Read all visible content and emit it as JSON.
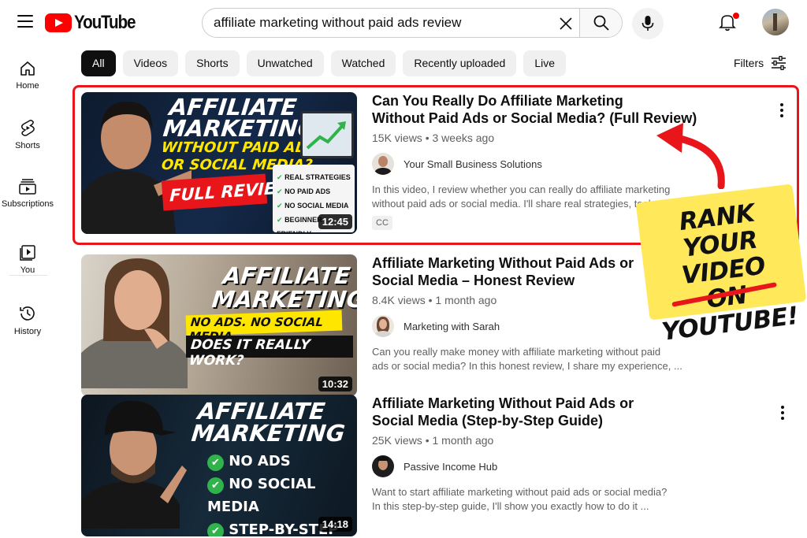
{
  "header": {
    "logo_text": "YouTube",
    "search_value": "affiliate marketing without paid ads review"
  },
  "sidebar": {
    "items": [
      {
        "label": "Home",
        "icon": "home-icon"
      },
      {
        "label": "Shorts",
        "icon": "shorts-icon"
      },
      {
        "label": "Subscriptions",
        "icon": "subscriptions-icon"
      },
      {
        "label": "You",
        "icon": "you-icon"
      },
      {
        "label": "History",
        "icon": "history-icon"
      }
    ]
  },
  "chips": [
    "All",
    "Videos",
    "Shorts",
    "Unwatched",
    "Watched",
    "Recently uploaded",
    "Live"
  ],
  "filters_label": "Filters",
  "results": [
    {
      "title_line1": "Can You Really Do Affiliate Marketing",
      "title_line2": "Without Paid Ads or Social Media? (Full Review)",
      "views": "15K views",
      "age": "3 weeks ago",
      "channel": "Your Small Business Solutions",
      "desc_line1": "In this video, I review whether you can really do affiliate marketing",
      "desc_line2": "without paid ads or social media. I'll share real strategies, tools, ...",
      "badge": "CC",
      "duration": "12:45",
      "thumb": {
        "line1": "AFFILIATE",
        "line2": "MARKETING",
        "line3": "WITHOUT PAID ADS",
        "line4": "OR SOCIAL MEDIA?",
        "banner": "FULL REVIEW",
        "checks": [
          "REAL STRATEGIES",
          "NO PAID ADS",
          "NO SOCIAL MEDIA",
          "BEGINNER FRIENDLY"
        ]
      }
    },
    {
      "title_line1": "Affiliate Marketing Without Paid Ads or",
      "title_line2": "Social Media – Honest Review",
      "views": "8.4K views",
      "age": "1 month ago",
      "channel": "Marketing with Sarah",
      "desc_line1": "Can you really make money with affiliate marketing without paid",
      "desc_line2": "ads or social media? In this honest review, I share my experience, ...",
      "duration": "10:32",
      "thumb": {
        "line1": "AFFILIATE",
        "line2": "MARKETING",
        "line3": "NO ADS. NO SOCIAL MEDIA.",
        "line4": "DOES IT REALLY WORK?"
      }
    },
    {
      "title_line1": "Affiliate Marketing Without Paid Ads or",
      "title_line2": "Social Media (Step-by-Step Guide)",
      "views": "25K views",
      "age": "1 month ago",
      "channel": "Passive Income Hub",
      "desc_line1": "Want to start affiliate marketing without paid ads or social media?",
      "desc_line2": "In this step-by-step guide, I'll show you exactly how to do it ...",
      "duration": "14:18",
      "thumb": {
        "line1": "AFFILIATE",
        "line2": "MARKETING",
        "checks": [
          "NO ADS",
          "NO SOCIAL MEDIA",
          "STEP-BY-STEP"
        ]
      }
    }
  ],
  "promo": {
    "line1": "RANK",
    "line2": "YOUR VIDEO",
    "line3": "ON YOUTUBE!"
  },
  "colors": {
    "brand_red": "#ff0000",
    "highlight_red": "#e8161b",
    "sticker_yellow": "#ffe95a",
    "check_green": "#2fb34a",
    "thumb_yellow": "#ffe600"
  }
}
